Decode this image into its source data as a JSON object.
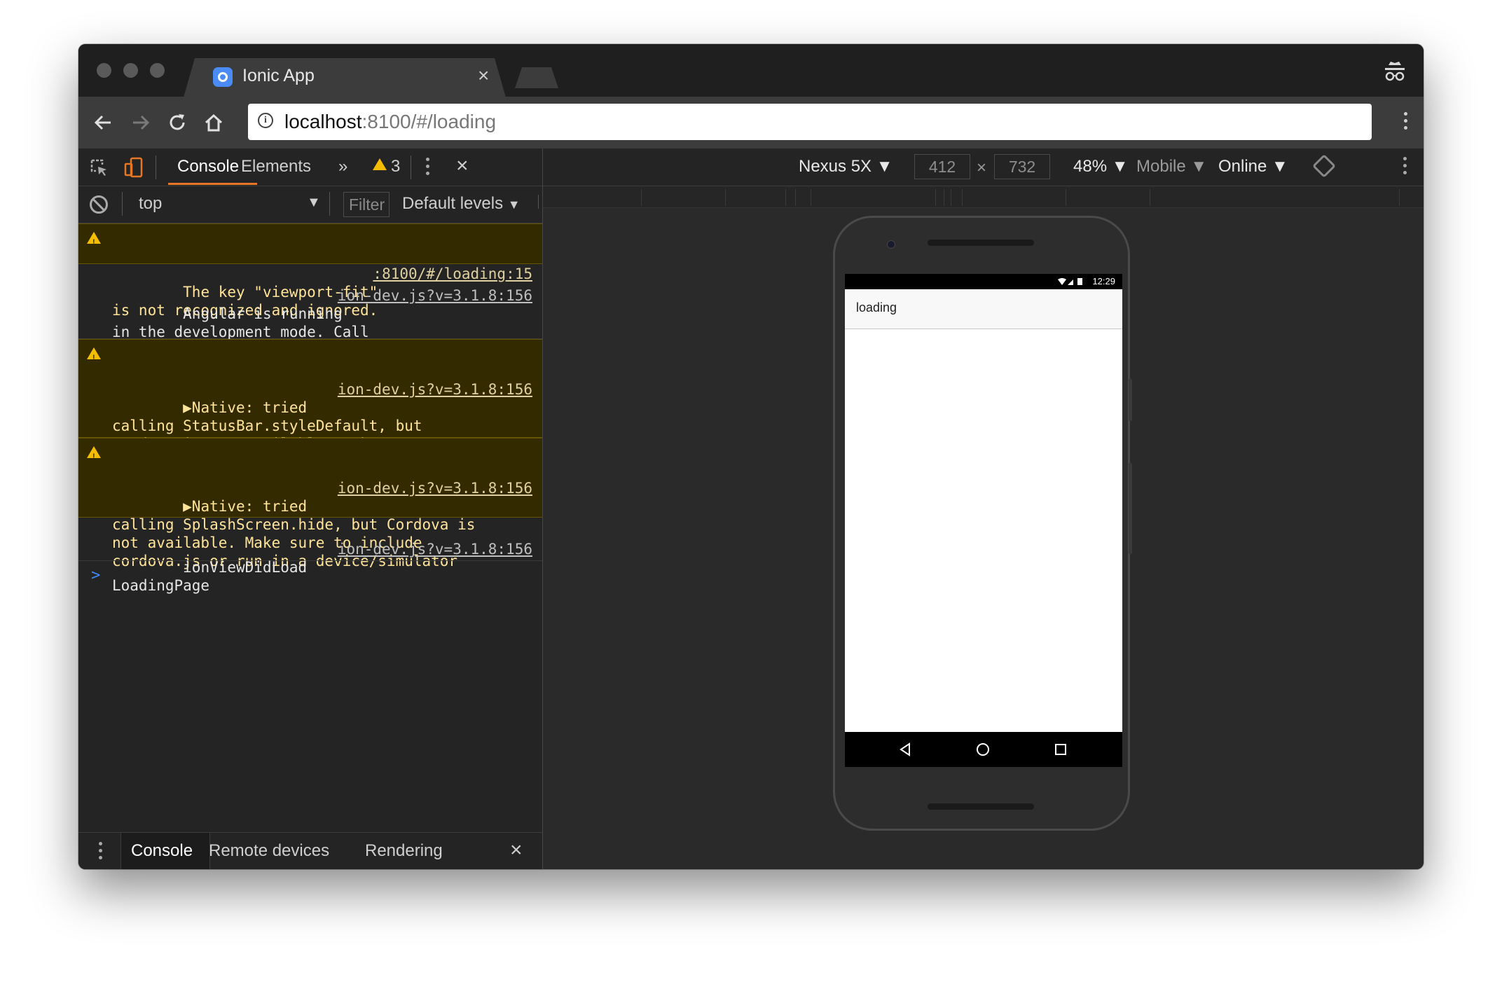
{
  "browser": {
    "tab_title": "Ionic App",
    "tab_close": "×",
    "url_host": "localhost",
    "url_path": ":8100/#/loading"
  },
  "devtools": {
    "tabs": [
      "Console",
      "Elements"
    ],
    "more_tabs": "»",
    "warning_count": "3",
    "close": "×",
    "context": "top",
    "filter_placeholder": "Filter",
    "levels": "Default levels"
  },
  "console": {
    "messages": [
      {
        "level": "warning",
        "text": "The key \"viewport-fit\"\nis not recognized and ignored.",
        "source": ":8100/#/loading:15"
      },
      {
        "level": "info",
        "text": "Angular is running\nin the development mode. Call\nenableProdMode() to enable the production\nmode.",
        "source": "ion-dev.js?v=3.1.8:156"
      },
      {
        "level": "warning",
        "text": "▶Native: tried\ncalling StatusBar.styleDefault, but\nCordova is not available. Make sure to\ninclude cordova.js or run in a\ndevice/simulator",
        "source": "ion-dev.js?v=3.1.8:156"
      },
      {
        "level": "warning",
        "text": "▶Native: tried\ncalling SplashScreen.hide, but Cordova is\nnot available. Make sure to include\ncordova.js or run in a device/simulator",
        "source": "ion-dev.js?v=3.1.8:156"
      },
      {
        "level": "info",
        "text": "ionViewDidLoad\nLoadingPage",
        "source": "ion-dev.js?v=3.1.8:156"
      }
    ],
    "prompt": ">"
  },
  "drawer": {
    "tabs": [
      "Console",
      "Remote devices",
      "Rendering"
    ],
    "close": "×"
  },
  "device_toolbar": {
    "device": "Nexus 5X ▼",
    "width": "412",
    "times": "×",
    "height": "732",
    "zoom": "48% ▼",
    "mode": "Mobile ▼",
    "network": "Online ▼"
  },
  "phone": {
    "time": "12:29",
    "page_title": "loading"
  }
}
